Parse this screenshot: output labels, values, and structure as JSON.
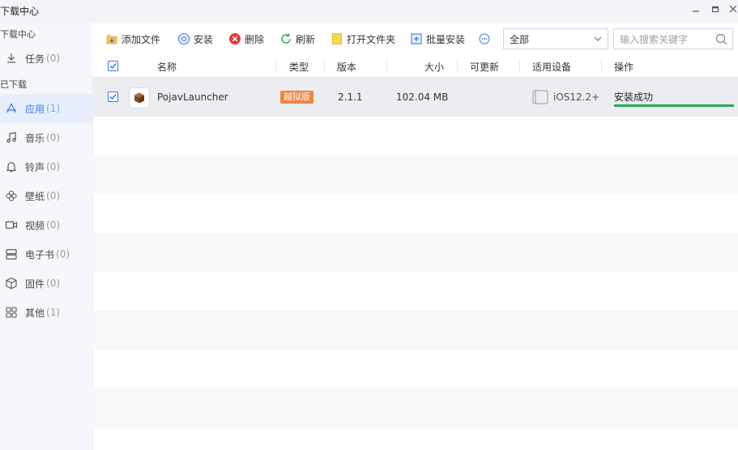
{
  "window": {
    "title": "下载中心",
    "controls": [
      "minimize",
      "maximize",
      "close"
    ]
  },
  "sidebar": {
    "section_downloading": "下载中心",
    "section_downloaded": "已下载",
    "items": [
      {
        "label": "任务",
        "count": "(0)",
        "icon": "download-icon"
      },
      {
        "label": "应用",
        "count": "(1)",
        "icon": "app-icon",
        "active": true
      },
      {
        "label": "音乐",
        "count": "(0)",
        "icon": "music-icon"
      },
      {
        "label": "铃声",
        "count": "(0)",
        "icon": "bell-icon"
      },
      {
        "label": "壁纸",
        "count": "(0)",
        "icon": "wallpaper-icon"
      },
      {
        "label": "视频",
        "count": "(0)",
        "icon": "video-icon"
      },
      {
        "label": "电子书",
        "count": "(0)",
        "icon": "ebook-icon"
      },
      {
        "label": "固件",
        "count": "(0)",
        "icon": "firmware-icon"
      },
      {
        "label": "其他",
        "count": "(1)",
        "icon": "other-icon"
      }
    ]
  },
  "toolbar": {
    "add_file": "添加文件",
    "install": "安装",
    "delete": "删除",
    "refresh": "刷新",
    "open_folder": "打开文件夹",
    "batch_install": "批量安装",
    "filter_value": "全部",
    "search_placeholder": "输入搜索关键字"
  },
  "table": {
    "headers": {
      "name": "名称",
      "type": "类型",
      "version": "版本",
      "size": "大小",
      "updatable": "可更新",
      "device": "适用设备",
      "action": "操作"
    },
    "rows": [
      {
        "checked": true,
        "name": "PojavLauncher",
        "type": "越狱版",
        "version": "2.1.1",
        "size": "102.04 MB",
        "updatable": "",
        "device": "iOS12.2+",
        "status": "安装成功",
        "progress": 1.0
      }
    ]
  },
  "colors": {
    "accent": "#3a78e8",
    "badge": "#f0853e",
    "success": "#27a85a",
    "delete": "#e5393a"
  }
}
